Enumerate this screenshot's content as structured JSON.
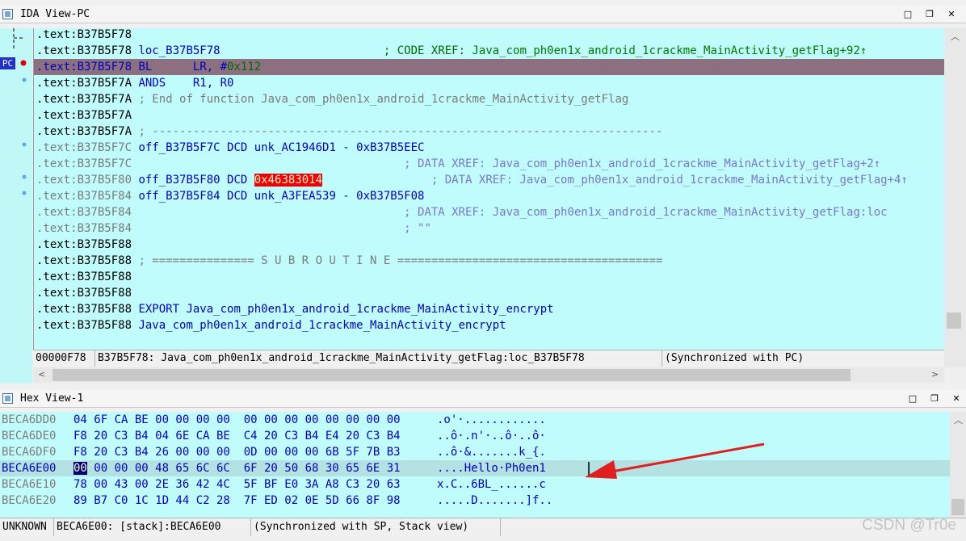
{
  "ida_panel": {
    "title": "IDA View-PC",
    "pc_label": "PC",
    "lines": [
      {
        "addr": ".text:B37B5F78",
        "addr_style": "c-black",
        "parts": []
      },
      {
        "addr": ".text:B37B5F78",
        "addr_style": "c-black",
        "parts": [
          {
            "text": " loc_B37B5F78",
            "style": "c-blue"
          },
          {
            "text": "                        ; CODE XREF: ",
            "style": "c-green"
          },
          {
            "text": "Java_com_ph0en1x_android_1crackme_MainActivity_getFlag+92↑",
            "style": "c-xref"
          }
        ]
      },
      {
        "addr": ".text:B37B5F78",
        "addr_style": "c-blue",
        "current": true,
        "parts": [
          {
            "text": " BL      LR, #",
            "style": "c-blue"
          },
          {
            "text": "0x112",
            "style": "c-green"
          }
        ]
      },
      {
        "addr": ".text:B37B5F7A",
        "addr_style": "c-black",
        "parts": [
          {
            "text": " ANDS    R1, R0",
            "style": "c-blue"
          }
        ]
      },
      {
        "addr": ".text:B37B5F7A",
        "addr_style": "c-black",
        "parts": [
          {
            "text": " ; End of function Java_com_ph0en1x_android_1crackme_MainActivity_getFlag",
            "style": "c-grey"
          }
        ]
      },
      {
        "addr": ".text:B37B5F7A",
        "addr_style": "c-black",
        "parts": []
      },
      {
        "addr": ".text:B37B5F7A",
        "addr_style": "c-black",
        "parts": [
          {
            "text": " ; ---------------------------------------------------------------------------",
            "style": "c-grey"
          }
        ]
      },
      {
        "addr": ".text:B37B5F7C",
        "addr_style": "c-grey",
        "parts": [
          {
            "text": " off_B37B5F7C DCD unk_AC1946D1 - 0xB37B5EEC",
            "style": "c-blue"
          }
        ]
      },
      {
        "addr": ".text:B37B5F7C",
        "addr_style": "c-grey",
        "parts": [
          {
            "text": "                                        ; DATA XREF: Java_com_ph0en1x_android_1crackme_MainActivity_getFlag+2↑",
            "style": "c-cmt"
          }
        ]
      },
      {
        "addr": ".text:B37B5F80",
        "addr_style": "c-grey",
        "parts": [
          {
            "text": " off_B37B5F80 DCD ",
            "style": "c-blue"
          },
          {
            "text": "0x46383014",
            "style": "c-redbg"
          },
          {
            "text": "                ; DATA XREF: Java_com_ph0en1x_android_1crackme_MainActivity_getFlag+4↑",
            "style": "c-cmt"
          }
        ]
      },
      {
        "addr": ".text:B37B5F84",
        "addr_style": "c-grey",
        "parts": [
          {
            "text": " off_B37B5F84 DCD unk_A3FEA539 - 0xB37B5F08",
            "style": "c-blue"
          }
        ]
      },
      {
        "addr": ".text:B37B5F84",
        "addr_style": "c-grey",
        "parts": [
          {
            "text": "                                        ; DATA XREF: Java_com_ph0en1x_android_1crackme_MainActivity_getFlag:loc",
            "style": "c-cmt"
          }
        ]
      },
      {
        "addr": ".text:B37B5F84",
        "addr_style": "c-grey",
        "parts": [
          {
            "text": "                                        ; \"\"",
            "style": "c-cmt"
          }
        ]
      },
      {
        "addr": ".text:B37B5F88",
        "addr_style": "c-black",
        "parts": []
      },
      {
        "addr": ".text:B37B5F88",
        "addr_style": "c-black",
        "parts": [
          {
            "text": " ; =============== S U B R O U T I N E =======================================",
            "style": "c-grey"
          }
        ]
      },
      {
        "addr": ".text:B37B5F88",
        "addr_style": "c-black",
        "parts": []
      },
      {
        "addr": ".text:B37B5F88",
        "addr_style": "c-black",
        "parts": []
      },
      {
        "addr": ".text:B37B5F88",
        "addr_style": "c-black",
        "parts": [
          {
            "text": " EXPORT Java_com_ph0en1x_android_1crackme_MainActivity_encrypt",
            "style": "c-blue"
          }
        ]
      },
      {
        "addr": ".text:B37B5F88",
        "addr_style": "c-black",
        "parts": [
          {
            "text": " Java_com_ph0en1x_android_1crackme_MainActivity_encrypt",
            "style": "c-blue"
          }
        ]
      }
    ],
    "status": {
      "offset": "00000F78",
      "location": "B37B5F78: Java_com_ph0en1x_android_1crackme_MainActivity_getFlag:loc_B37B5F78",
      "sync": "(Synchronized with PC)"
    }
  },
  "hex_panel": {
    "title": "Hex View-1",
    "rows": [
      {
        "addr": "BECA6DD0",
        "bytes": "04 6F CA BE 00 00 00 00  00 00 00 00 00 00 00 00",
        "ascii": ".o'·............"
      },
      {
        "addr": "BECA6DE0",
        "bytes": "F8 20 C3 B4 04 6E CA BE  C4 20 C3 B4 E4 20 C3 B4",
        "ascii": "..ô·.n'·..ô·..ô·"
      },
      {
        "addr": "BECA6DF0",
        "bytes": "F8 20 C3 B4 26 00 00 00  0D 00 00 00 6B 5F 7B B3",
        "ascii": "..ô·&.......k_{."
      },
      {
        "addr": "BECA6E00",
        "current": true,
        "sel": "00",
        "bytes": " 00 00 00 48 65 6C 6C  6F 20 50 68 30 65 6E 31",
        "ascii": "....Hello·Ph0en1"
      },
      {
        "addr": "BECA6E10",
        "bytes": "78 00 43 00 2E 36 42 4C  5F BF E0 3A A8 C3 20 63",
        "ascii": "x.C..6BL_......c"
      },
      {
        "addr": "BECA6E20",
        "bytes": "89 B7 C0 1C 1D 44 C2 28  7F ED 02 0E 5D 66 8F 98",
        "ascii": ".....D.......]f.."
      }
    ],
    "status": {
      "mode": "UNKNOWN",
      "location": "BECA6E00: [stack]:BECA6E00",
      "sync": "(Synchronized with SP, Stack view)"
    }
  },
  "watermark": "CSDN @Tr0e",
  "icons": [
    "panel-icon",
    "minimize-icon",
    "restore-icon",
    "close-icon",
    "arrow-icon"
  ],
  "colors": {
    "view_bg": "#c0fcfc",
    "current_line": "#8c7080",
    "arrow": "#e02020",
    "highlight": "#f00000"
  }
}
